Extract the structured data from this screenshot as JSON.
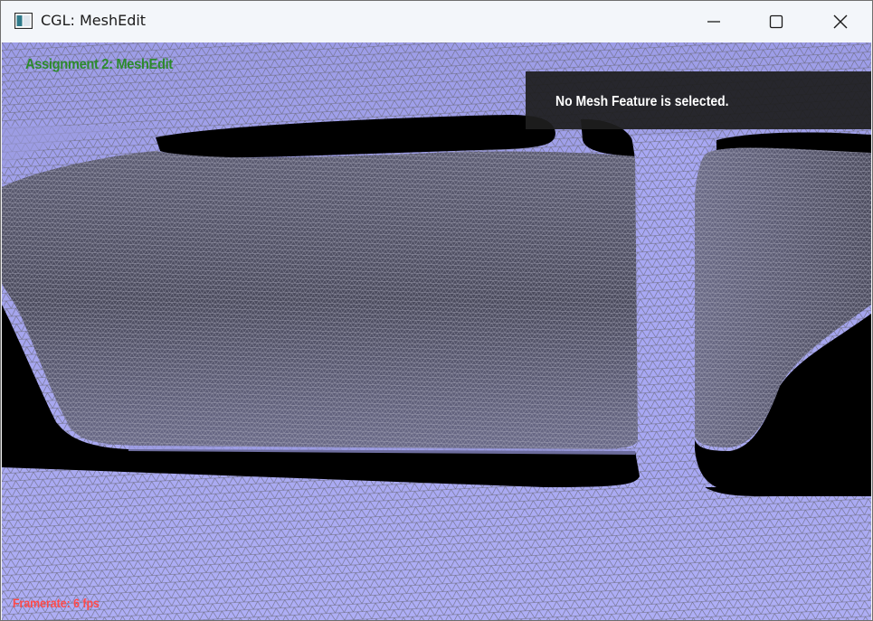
{
  "window": {
    "title": "CGL: MeshEdit",
    "app_icon": "window-app-icon",
    "controls": {
      "minimize_icon": "minimize-icon",
      "maximize_icon": "maximize-icon",
      "close_icon": "close-icon"
    }
  },
  "viewport": {
    "hud_title": "Assignment 2: MeshEdit",
    "selection_status": "No Mesh Feature is selected.",
    "framerate": "Framerate: 6 fps"
  },
  "colors": {
    "mesh_fill_light": "#aaaaf2",
    "mesh_fill_shadow": "#55556a",
    "wire": "#6a6a7a",
    "hole": "#000000",
    "hud_title": "#2c8a2c",
    "framerate": "#ff4a4a",
    "panel_bg": "#1e1e1e"
  }
}
